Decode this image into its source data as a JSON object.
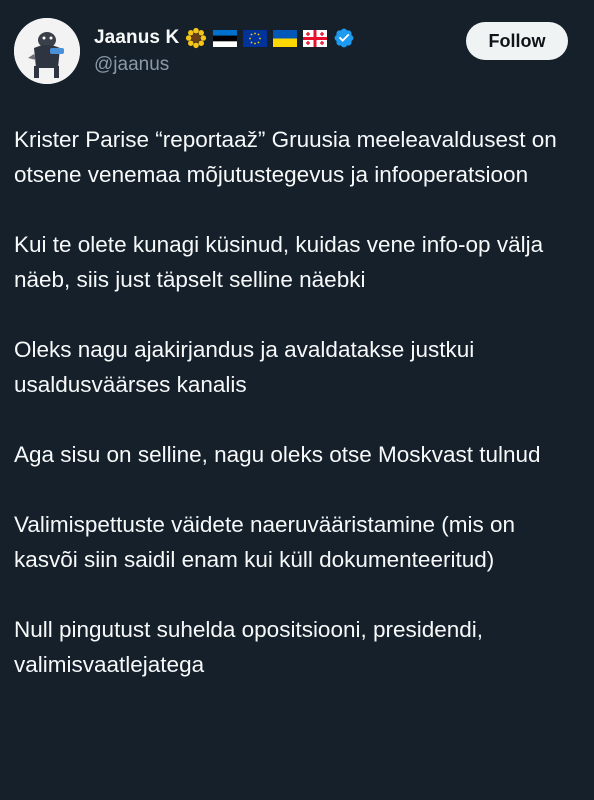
{
  "author": {
    "display_name": "Jaanus K",
    "handle": "@jaanus",
    "verified": true,
    "badges": [
      "sunflower-icon",
      "estonia-flag-icon",
      "eu-flag-icon",
      "ukraine-flag-icon",
      "georgia-flag-icon"
    ]
  },
  "follow_label": "Follow",
  "tweet": {
    "paragraphs": [
      "Krister Parise “reportaaž” Gruusia meeleavaldusest on otsene venemaa mõjutustegevus ja infooperatsioon",
      "Kui te olete kunagi küsinud, kuidas vene info-op välja näeb, siis just täpselt selline näebki",
      "Oleks nagu ajakirjandus ja avaldatakse justkui usaldusväärses kanalis",
      "Aga sisu on selline, nagu oleks otse Moskvast tulnud",
      "Valimispettuste väidete naeruvääristamine (mis on kasvõi siin saidil enam kui küll dokumenteeritud)",
      "Null pingutust suhelda opositsiooni, presidendi, valimisvaatlejatega"
    ]
  },
  "colors": {
    "background": "#15202b",
    "text": "#f7f9f9",
    "secondary_text": "#8b98a5",
    "verified_blue": "#1d9bf0",
    "button_bg": "#eff3f4"
  }
}
